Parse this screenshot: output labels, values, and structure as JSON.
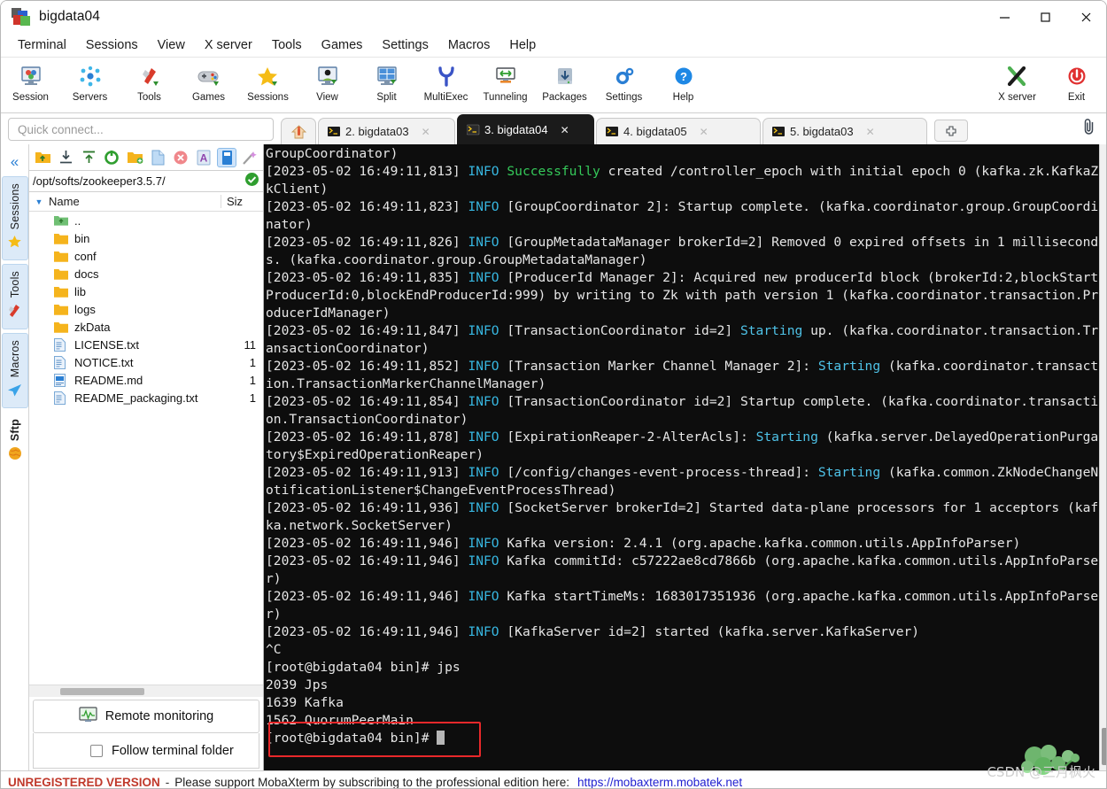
{
  "window": {
    "title": "bigdata04",
    "minimize": "—",
    "maximize": "☐",
    "close": "✕"
  },
  "menubar": {
    "items": [
      "Terminal",
      "Sessions",
      "View",
      "X server",
      "Tools",
      "Games",
      "Settings",
      "Macros",
      "Help"
    ]
  },
  "ribbon": {
    "left_buttons": [
      {
        "label": "Session",
        "icon": "session-icon"
      },
      {
        "label": "Servers",
        "icon": "servers-icon"
      },
      {
        "label": "Tools",
        "icon": "tools-icon"
      },
      {
        "label": "Games",
        "icon": "games-icon"
      },
      {
        "label": "Sessions",
        "icon": "sessions-star-icon"
      },
      {
        "label": "View",
        "icon": "view-icon"
      },
      {
        "label": "Split",
        "icon": "split-icon"
      },
      {
        "label": "MultiExec",
        "icon": "multiexec-icon"
      },
      {
        "label": "Tunneling",
        "icon": "tunneling-icon"
      },
      {
        "label": "Packages",
        "icon": "packages-icon"
      },
      {
        "label": "Settings",
        "icon": "settings-gear-icon"
      },
      {
        "label": "Help",
        "icon": "help-icon"
      }
    ],
    "right_buttons": [
      {
        "label": "X server",
        "icon": "xserver-icon"
      },
      {
        "label": "Exit",
        "icon": "exit-power-icon"
      }
    ]
  },
  "quick_connect": {
    "placeholder": "Quick connect..."
  },
  "tabs": {
    "home_icon": "home-icon",
    "items": [
      {
        "label": "2. bigdata03",
        "active": false,
        "close": "✕"
      },
      {
        "label": "3. bigdata04",
        "active": true,
        "close": "✕"
      },
      {
        "label": "4. bigdata05",
        "active": false,
        "close": "✕"
      },
      {
        "label": "5. bigdata03",
        "active": false,
        "close": "✕"
      }
    ],
    "new_tab": "✚"
  },
  "side_strip": {
    "collapse": "«",
    "tabs": [
      {
        "label": "Sessions",
        "icon": "star-icon",
        "selected": false
      },
      {
        "label": "Tools",
        "icon": "knife-icon",
        "selected": false
      },
      {
        "label": "Macros",
        "icon": "paperplane-icon",
        "selected": false
      },
      {
        "label": "Sftp",
        "icon": "globe-icon",
        "selected": true
      }
    ]
  },
  "sftp": {
    "toolbar_icons": [
      "go-up-icon",
      "download-icon",
      "upload-icon",
      "refresh-icon",
      "new-folder-icon",
      "new-file-icon",
      "delete-icon",
      "text-mode-icon",
      "binary-mode-icon",
      "magic-wand-icon"
    ],
    "path": "/opt/softs/zookeeper3.5.7/",
    "path_status_icon": "check-ok-icon",
    "columns": [
      "Name",
      "Siz"
    ],
    "files": [
      {
        "name": "..",
        "size": "",
        "type": "parent"
      },
      {
        "name": "bin",
        "size": "",
        "type": "folder"
      },
      {
        "name": "conf",
        "size": "",
        "type": "folder"
      },
      {
        "name": "docs",
        "size": "",
        "type": "folder"
      },
      {
        "name": "lib",
        "size": "",
        "type": "folder"
      },
      {
        "name": "logs",
        "size": "",
        "type": "folder"
      },
      {
        "name": "zkData",
        "size": "",
        "type": "folder"
      },
      {
        "name": "LICENSE.txt",
        "size": "11",
        "type": "text"
      },
      {
        "name": "NOTICE.txt",
        "size": "1",
        "type": "text"
      },
      {
        "name": "README.md",
        "size": "1",
        "type": "md"
      },
      {
        "name": "README_packaging.txt",
        "size": "1",
        "type": "text"
      }
    ],
    "remote_monitoring": "Remote monitoring",
    "follow_terminal_folder": "Follow terminal folder",
    "follow_checked": false
  },
  "terminal": {
    "lines": [
      [
        {
          "t": "GroupCoordinator)",
          "c": "n"
        }
      ],
      [
        {
          "t": "[2023-05-02 16:49:11,813] ",
          "c": "n"
        },
        {
          "t": "INFO ",
          "c": "info"
        },
        {
          "t": "Successfully ",
          "c": "grn"
        },
        {
          "t": "created /controller_epoch with initial epoch 0 (kafka.zk.KafkaZkClient)",
          "c": "n"
        }
      ],
      [
        {
          "t": "[2023-05-02 16:49:11,823] ",
          "c": "n"
        },
        {
          "t": "INFO ",
          "c": "info"
        },
        {
          "t": "[GroupCoordinator 2]: Startup complete. (kafka.coordinator.group.GroupCoordinator)",
          "c": "n"
        }
      ],
      [
        {
          "t": "[2023-05-02 16:49:11,826] ",
          "c": "n"
        },
        {
          "t": "INFO ",
          "c": "info"
        },
        {
          "t": "[GroupMetadataManager brokerId=2] Removed 0 expired offsets in 1 milliseconds. (kafka.coordinator.group.GroupMetadataManager)",
          "c": "n"
        }
      ],
      [
        {
          "t": "[2023-05-02 16:49:11,835] ",
          "c": "n"
        },
        {
          "t": "INFO ",
          "c": "info"
        },
        {
          "t": "[ProducerId Manager 2]: Acquired new producerId block (brokerId:2,blockStartProducerId:0,blockEndProducerId:999) by writing to Zk with path version 1 (kafka.coordinator.transaction.ProducerIdManager)",
          "c": "n"
        }
      ],
      [
        {
          "t": "[2023-05-02 16:49:11,847] ",
          "c": "n"
        },
        {
          "t": "INFO ",
          "c": "info"
        },
        {
          "t": "[TransactionCoordinator id=2] ",
          "c": "n"
        },
        {
          "t": "Starting ",
          "c": "cyn"
        },
        {
          "t": "up. (kafka.coordinator.transaction.TransactionCoordinator)",
          "c": "n"
        }
      ],
      [
        {
          "t": "[2023-05-02 16:49:11,852] ",
          "c": "n"
        },
        {
          "t": "INFO ",
          "c": "info"
        },
        {
          "t": "[Transaction Marker Channel Manager 2]: ",
          "c": "n"
        },
        {
          "t": "Starting ",
          "c": "cyn"
        },
        {
          "t": "(kafka.coordinator.transaction.TransactionMarkerChannelManager)",
          "c": "n"
        }
      ],
      [
        {
          "t": "[2023-05-02 16:49:11,854] ",
          "c": "n"
        },
        {
          "t": "INFO ",
          "c": "info"
        },
        {
          "t": "[TransactionCoordinator id=2] Startup complete. (kafka.coordinator.transaction.TransactionCoordinator)",
          "c": "n"
        }
      ],
      [
        {
          "t": "[2023-05-02 16:49:11,878] ",
          "c": "n"
        },
        {
          "t": "INFO ",
          "c": "info"
        },
        {
          "t": "[ExpirationReaper-2-AlterAcls]: ",
          "c": "n"
        },
        {
          "t": "Starting ",
          "c": "cyn"
        },
        {
          "t": "(kafka.server.DelayedOperationPurgatory$ExpiredOperationReaper)",
          "c": "n"
        }
      ],
      [
        {
          "t": "[2023-05-02 16:49:11,913] ",
          "c": "n"
        },
        {
          "t": "INFO ",
          "c": "info"
        },
        {
          "t": "[/config/changes-event-process-thread]: ",
          "c": "n"
        },
        {
          "t": "Starting ",
          "c": "cyn"
        },
        {
          "t": "(kafka.common.ZkNodeChangeNotificationListener$ChangeEventProcessThread)",
          "c": "n"
        }
      ],
      [
        {
          "t": "[2023-05-02 16:49:11,936] ",
          "c": "n"
        },
        {
          "t": "INFO ",
          "c": "info"
        },
        {
          "t": "[SocketServer brokerId=2] Started data-plane processors for 1 acceptors (kafka.network.SocketServer)",
          "c": "n"
        }
      ],
      [
        {
          "t": "[2023-05-02 16:49:11,946] ",
          "c": "n"
        },
        {
          "t": "INFO ",
          "c": "info"
        },
        {
          "t": "Kafka version: 2.4.1 (org.apache.kafka.common.utils.AppInfoParser)",
          "c": "n"
        }
      ],
      [
        {
          "t": "[2023-05-02 16:49:11,946] ",
          "c": "n"
        },
        {
          "t": "INFO ",
          "c": "info"
        },
        {
          "t": "Kafka commitId: c57222ae8cd7866b (org.apache.kafka.common.utils.AppInfoParser)",
          "c": "n"
        }
      ],
      [
        {
          "t": "[2023-05-02 16:49:11,946] ",
          "c": "n"
        },
        {
          "t": "INFO ",
          "c": "info"
        },
        {
          "t": "Kafka startTimeMs: 1683017351936 (org.apache.kafka.common.utils.AppInfoParser)",
          "c": "n"
        }
      ],
      [
        {
          "t": "[2023-05-02 16:49:11,946] ",
          "c": "n"
        },
        {
          "t": "INFO ",
          "c": "info"
        },
        {
          "t": "[KafkaServer id=2] started (kafka.server.KafkaServer)",
          "c": "n"
        }
      ],
      [
        {
          "t": "^C",
          "c": "n"
        }
      ],
      [
        {
          "t": "[root@bigdata04 bin]# jps",
          "c": "n"
        }
      ],
      [
        {
          "t": "2039 Jps",
          "c": "n"
        }
      ],
      [
        {
          "t": "1639 Kafka",
          "c": "n"
        }
      ],
      [
        {
          "t": "1562 QuorumPeerMain",
          "c": "n"
        }
      ],
      [
        {
          "t": "[root@bigdata04 bin]# ",
          "c": "n",
          "cursor": true
        }
      ]
    ],
    "highlight_note": "red-rectangle around Kafka and QuorumPeerMain processes"
  },
  "statusbar": {
    "unregistered": "UNREGISTERED VERSION",
    "dash": "-",
    "message": "Please support MobaXterm by subscribing to the professional edition here:",
    "link": "https://mobaxterm.mobatek.net"
  },
  "watermark": {
    "text": "CSDN @三月枫火"
  },
  "colors": {
    "accent": "#2a7fd4",
    "terminal_bg": "#0d0d0d",
    "terminal_fg": "#e6e6e6",
    "info_blue": "#37b6e0",
    "green": "#35c95a",
    "highlight_red": "#e8282a",
    "folder_yellow": "#f5b41d"
  }
}
